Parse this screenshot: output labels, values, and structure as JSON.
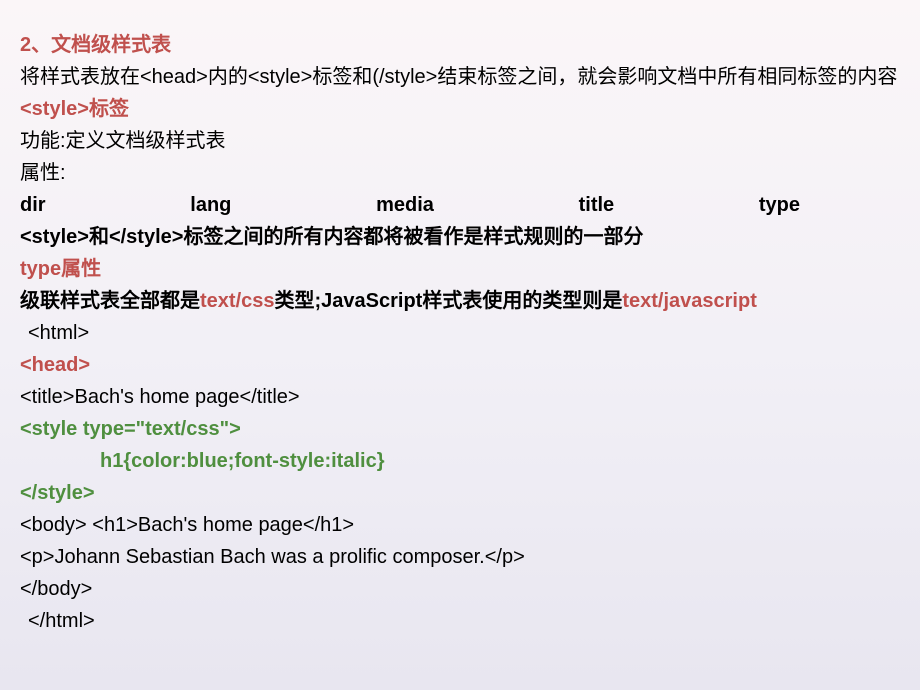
{
  "heading": "2、文档级样式表",
  "para1": "将样式表放在<head>内的<style>标签和(/style>结束标签之间，就会影响文档中所有相同标签的内容",
  "styleTag": {
    "tag": "<style>",
    "label": "标签"
  },
  "func": "功能:定义文档级样式表",
  "attrLabel": "属性:",
  "attrs": [
    "dir",
    "lang",
    "media",
    "title",
    "type"
  ],
  "between": "<style>和</style>标签之间的所有内容都将被看作是样式规则的一部分",
  "typeAttr": {
    "name": "type",
    "label": "属性"
  },
  "cascade": {
    "p1": "级联样式表全部都是",
    "v1": "text/css",
    "p2": "类型;JavaScript样式表使用的类型则是",
    "v2": "text/javascript"
  },
  "code": {
    "htmlOpen": "<html>",
    "headOpen": "<head>",
    "title": "<title>Bach's home page</title>",
    "styleOpen": "<style type=\"text/css\">",
    "rule": "h1{color:blue;font-style:italic}",
    "styleClose": "</style>",
    "bodyLine": "<body> <h1>Bach's home page</h1>",
    "p": "<p>Johann Sebastian Bach was a prolific composer.</p>",
    "bodyClose": "</body>",
    "htmlClose": "</html>"
  }
}
